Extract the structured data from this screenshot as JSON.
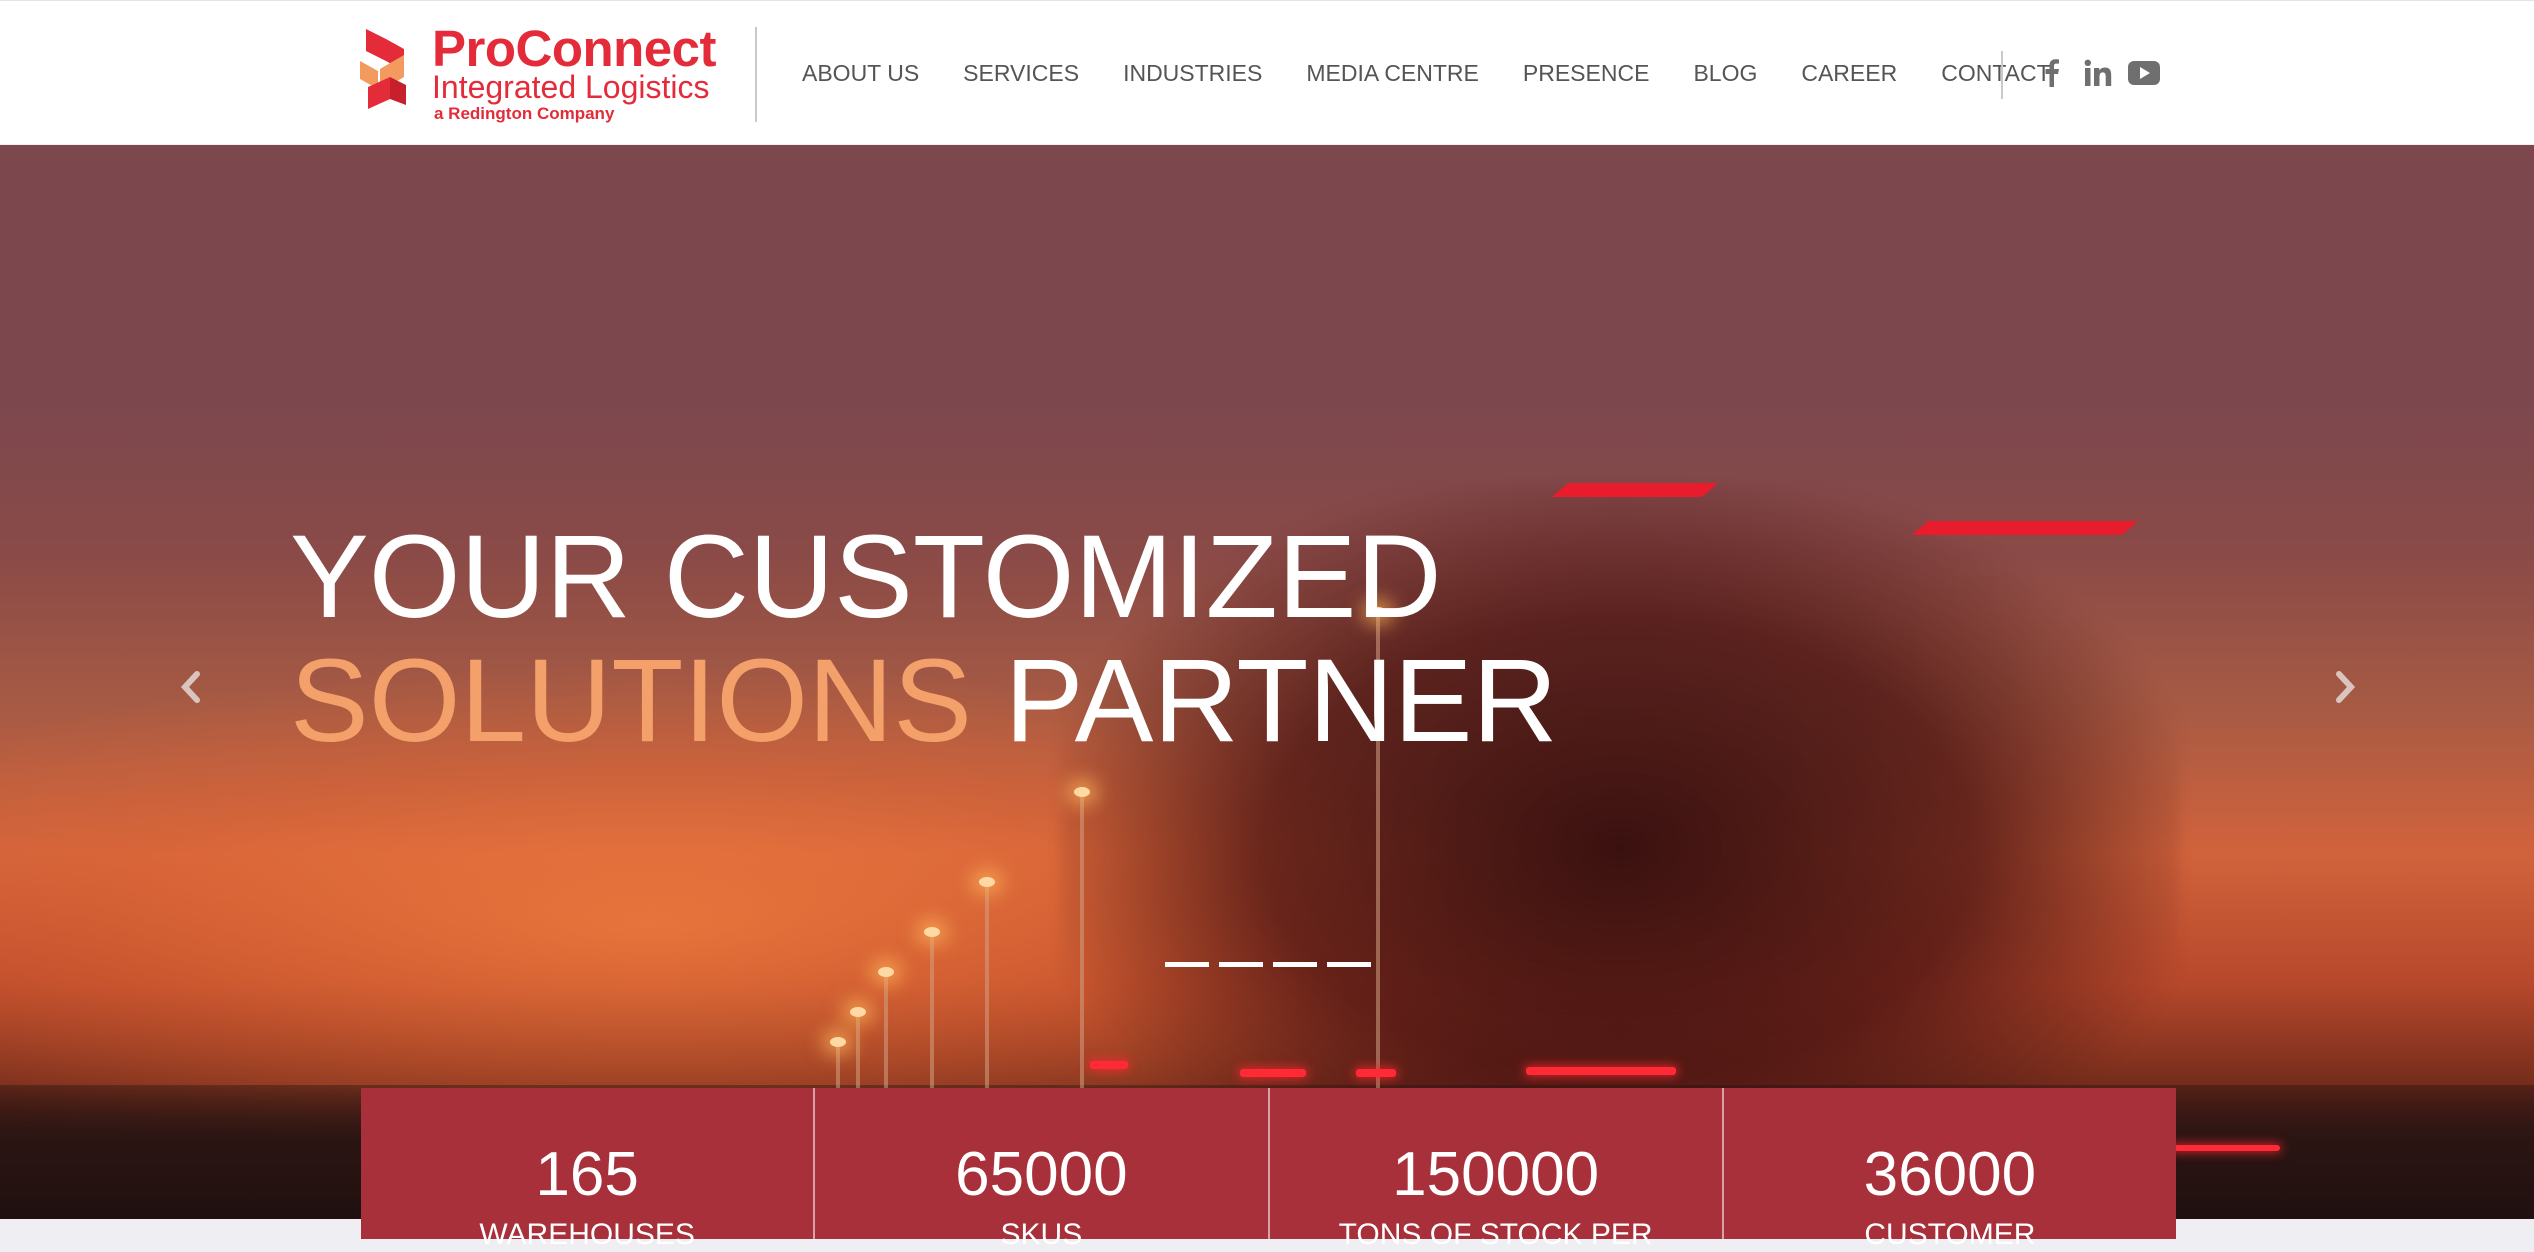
{
  "brand": {
    "title": "ProConnect",
    "subtitle": "Integrated Logistics",
    "tagline": "a Redington Company",
    "color": "#e42b39"
  },
  "nav": {
    "items": [
      {
        "label": "ABOUT US"
      },
      {
        "label": "SERVICES"
      },
      {
        "label": "INDUSTRIES"
      },
      {
        "label": "MEDIA CENTRE"
      },
      {
        "label": "PRESENCE"
      },
      {
        "label": "BLOG"
      },
      {
        "label": "CAREER"
      },
      {
        "label": "CONTACT"
      }
    ]
  },
  "social": {
    "icons": [
      "facebook-icon",
      "linkedin-icon",
      "youtube-icon"
    ]
  },
  "hero": {
    "line1": "YOUR CUSTOMIZED",
    "line2_accent": "SOLUTIONS",
    "line2_rest": " PARTNER",
    "accent_color": "#f3a06b",
    "slide_count": 4,
    "prev_icon": "chevron-left-icon",
    "next_icon": "chevron-right-icon"
  },
  "stats": {
    "background": "#a8303a",
    "items": [
      {
        "value": "165",
        "label": "WAREHOUSES"
      },
      {
        "value": "65000",
        "label": "SKUS"
      },
      {
        "value": "150000",
        "label": "TONS OF STOCK PER"
      },
      {
        "value": "36000",
        "label": "CUSTOMER"
      }
    ]
  }
}
